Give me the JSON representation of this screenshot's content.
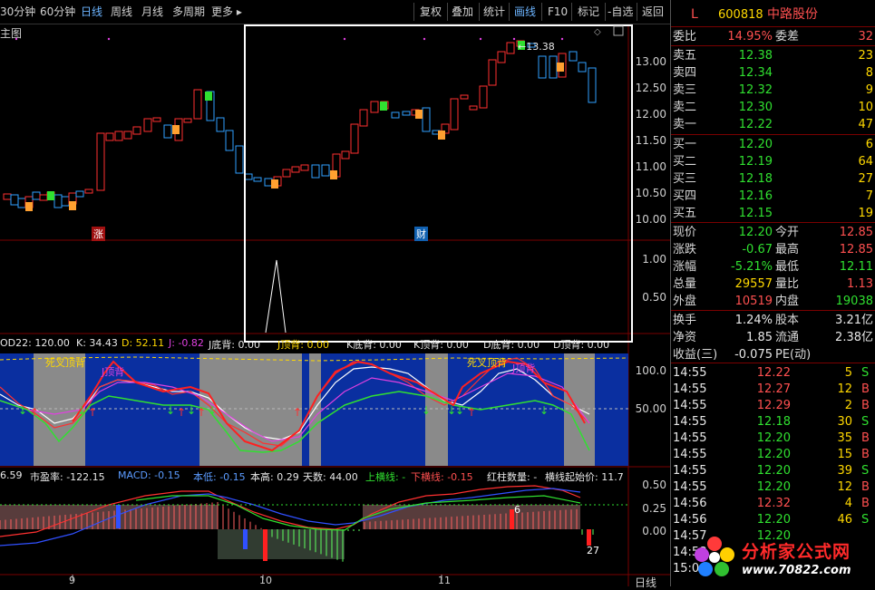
{
  "toolbar": {
    "periods": [
      "30分钟",
      "60分钟",
      "日线",
      "周线",
      "月线",
      "多周期",
      "更多"
    ],
    "active_period": "日线",
    "more_arrow": "triangle-right",
    "tools": [
      "复权",
      "叠加",
      "统计",
      "画线",
      "F10",
      "标记",
      "自选",
      "返回"
    ]
  },
  "main_chart": {
    "label": "主图",
    "price_axis": [
      "13.00",
      "12.50",
      "12.00",
      "11.50",
      "11.00",
      "10.50",
      "10.00"
    ],
    "max_label": "13.38",
    "marker_zhang": "涨",
    "marker_cai": "财",
    "sub_axis": [
      "1.00",
      "0.50"
    ]
  },
  "kdj_panel": {
    "header": [
      {
        "text": "OD22: 120.00",
        "color": "#e8e8e8"
      },
      {
        "text": "K: 34.43",
        "color": "#e8e8e8"
      },
      {
        "text": "D: 52.11",
        "color": "#ffd800"
      },
      {
        "text": "J: -0.82",
        "color": "#e040e0"
      },
      {
        "text": "J底背: 0.00",
        "color": "#e8e8e8"
      },
      {
        "text": "J顶背: 0.00",
        "color": "#ffd800"
      },
      {
        "text": "K底背: 0.00",
        "color": "#e8e8e8"
      },
      {
        "text": "K顶背: 0.00",
        "color": "#e8e8e8"
      },
      {
        "text": "D底背: 0.00",
        "color": "#e8e8e8"
      },
      {
        "text": "D顶背: 0.00",
        "color": "#e8e8e8"
      }
    ],
    "axis": [
      "100.0",
      "50.00"
    ],
    "labels": [
      "死叉顶背",
      "J顶背",
      "死叉顶背",
      "J顶背"
    ]
  },
  "macd_panel": {
    "header": [
      {
        "text": "6.59",
        "color": "#e8e8e8"
      },
      {
        "text": "市盈率: -122.15",
        "color": "#e8e8e8"
      },
      {
        "text": "MACD: -0.15",
        "color": "#5b9bff"
      },
      {
        "text": "本低: -0.15",
        "color": "#5b9bff"
      },
      {
        "text": "本高: 0.29",
        "color": "#e8e8e8"
      },
      {
        "text": "天数: 44.00",
        "color": "#e8e8e8"
      },
      {
        "text": "上横线: -",
        "color": "#30e030"
      },
      {
        "text": "下横线: -0.15",
        "color": "#ff5050"
      },
      {
        "text": "红柱数量: -",
        "color": "#e8e8e8"
      },
      {
        "text": "横线起始价: 11.7",
        "color": "#e8e8e8"
      }
    ],
    "axis": [
      "0.50",
      "0.25",
      "0.00"
    ],
    "days_label": "27",
    "six_label": "6"
  },
  "date_axis": [
    "9",
    "10",
    "11"
  ],
  "date_axis_right": "日线",
  "quote_panel": {
    "market": "L",
    "code": "600818",
    "name": "中路股份",
    "weibi_label": "委比",
    "weibi": "14.95%",
    "weicha_label": "委差",
    "weicha": "32",
    "asks": [
      {
        "label": "卖五",
        "price": "12.38",
        "vol": "23"
      },
      {
        "label": "卖四",
        "price": "12.34",
        "vol": "8"
      },
      {
        "label": "卖三",
        "price": "12.32",
        "vol": "9"
      },
      {
        "label": "卖二",
        "price": "12.30",
        "vol": "10"
      },
      {
        "label": "卖一",
        "price": "12.22",
        "vol": "47"
      }
    ],
    "bids": [
      {
        "label": "买一",
        "price": "12.20",
        "vol": "6"
      },
      {
        "label": "买二",
        "price": "12.19",
        "vol": "64"
      },
      {
        "label": "买三",
        "price": "12.18",
        "vol": "27"
      },
      {
        "label": "买四",
        "price": "12.16",
        "vol": "7"
      },
      {
        "label": "买五",
        "price": "12.15",
        "vol": "19"
      }
    ],
    "stats": [
      {
        "l1": "现价",
        "v1": "12.20",
        "c1": "green",
        "l2": "今开",
        "v2": "12.85",
        "c2": "red"
      },
      {
        "l1": "涨跌",
        "v1": "-0.67",
        "c1": "green",
        "l2": "最高",
        "v2": "12.85",
        "c2": "red"
      },
      {
        "l1": "涨幅",
        "v1": "-5.21%",
        "c1": "green",
        "l2": "最低",
        "v2": "12.11",
        "c2": "green"
      },
      {
        "l1": "总量",
        "v1": "29557",
        "c1": "yel",
        "l2": "量比",
        "v2": "1.13",
        "c2": "red"
      },
      {
        "l1": "外盘",
        "v1": "10519",
        "c1": "red",
        "l2": "内盘",
        "v2": "19038",
        "c2": "green"
      }
    ],
    "stats2": [
      {
        "l1": "换手",
        "v1": "1.24%",
        "c1": "wht",
        "l2": "股本",
        "v2": "3.21亿",
        "c2": "wht"
      },
      {
        "l1": "净资",
        "v1": "1.85",
        "c1": "wht",
        "l2": "流通",
        "v2": "2.38亿",
        "c2": "wht"
      },
      {
        "l1": "收益(三)",
        "v1": "-0.075",
        "c1": "wht",
        "l2": "PE(动)",
        "v2": "",
        "c2": "wht"
      }
    ],
    "ticks": [
      {
        "time": "14:55",
        "price": "12.22",
        "pc": "red",
        "vol": "5",
        "side": "S"
      },
      {
        "time": "14:55",
        "price": "12.27",
        "pc": "red",
        "vol": "12",
        "side": "B"
      },
      {
        "time": "14:55",
        "price": "12.29",
        "pc": "red",
        "vol": "2",
        "side": "B"
      },
      {
        "time": "14:55",
        "price": "12.18",
        "pc": "green",
        "vol": "30",
        "side": "S"
      },
      {
        "time": "14:55",
        "price": "12.20",
        "pc": "green",
        "vol": "35",
        "side": "B"
      },
      {
        "time": "14:55",
        "price": "12.20",
        "pc": "green",
        "vol": "15",
        "side": "B"
      },
      {
        "time": "14:55",
        "price": "12.20",
        "pc": "green",
        "vol": "39",
        "side": "S"
      },
      {
        "time": "14:55",
        "price": "12.20",
        "pc": "green",
        "vol": "12",
        "side": "B"
      },
      {
        "time": "14:56",
        "price": "12.32",
        "pc": "red",
        "vol": "4",
        "side": "B"
      },
      {
        "time": "14:56",
        "price": "12.20",
        "pc": "green",
        "vol": "46",
        "side": "S"
      },
      {
        "time": "14:57",
        "price": "12.20",
        "pc": "green",
        "vol": "",
        "side": ""
      },
      {
        "time": "14:58",
        "price": "",
        "pc": "green",
        "vol": "",
        "side": ""
      },
      {
        "time": "15:00",
        "price": "",
        "pc": "green",
        "vol": "",
        "side": ""
      }
    ]
  },
  "watermark": {
    "text": "分析家公式网",
    "url": "www.70822.com"
  },
  "colors": {
    "up": "#ff3030",
    "down": "#30a0ff",
    "kdj_bg": "#0a2fa0",
    "kdj_grey": "#808080"
  }
}
